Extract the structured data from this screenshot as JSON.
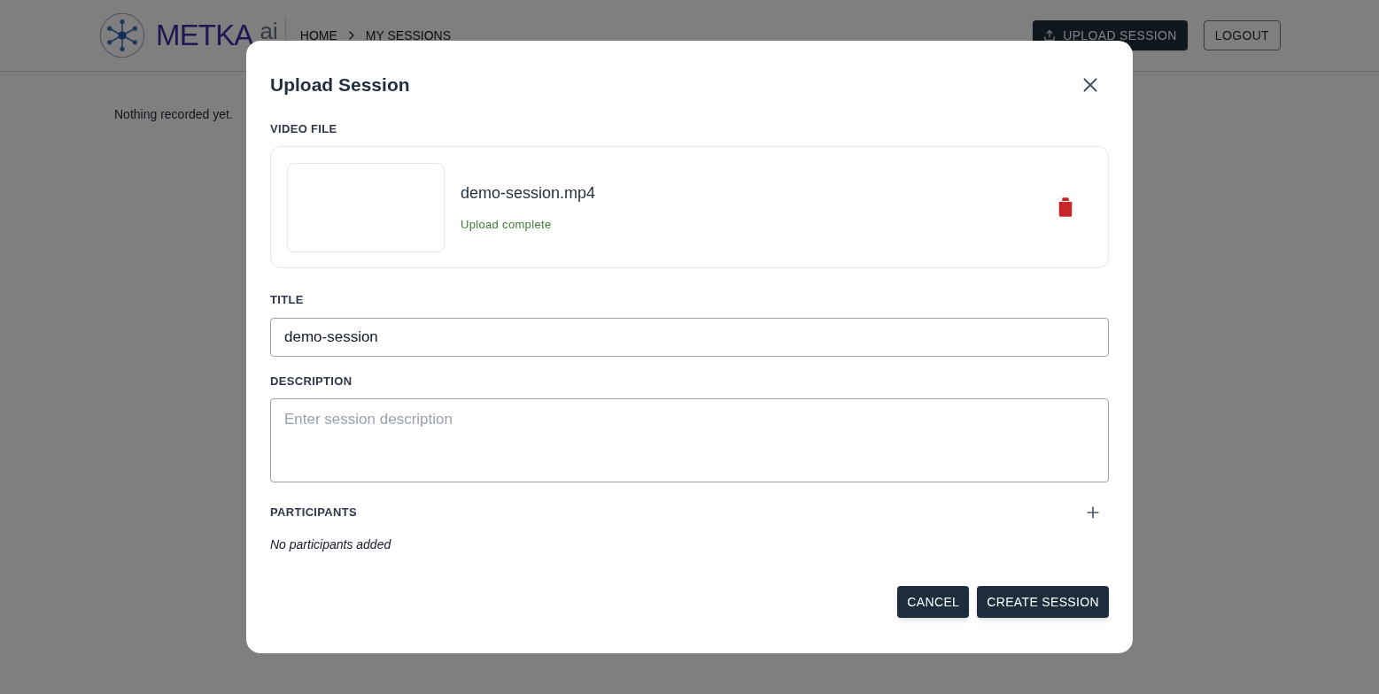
{
  "header": {
    "logo": {
      "name": "METKA",
      "suffix": "ai"
    },
    "breadcrumbs": [
      "HOME",
      "MY SESSIONS"
    ],
    "buttons": [
      {
        "label": "UPLOAD SESSION",
        "kind": "primary"
      },
      {
        "label": "LOGOUT",
        "kind": "outline"
      }
    ]
  },
  "page": {
    "empty_message": "Nothing recorded yet."
  },
  "dialog": {
    "title": "Upload Session",
    "video_file": {
      "label": "VIDEO FILE",
      "file_name": "demo-session.mp4",
      "status": "Upload complete"
    },
    "title_field": {
      "label": "TITLE",
      "value": "demo-session"
    },
    "description_field": {
      "label": "DESCRIPTION",
      "placeholder": "Enter session description"
    },
    "participants": {
      "label": "PARTICIPANTS",
      "empty_message": "No participants added"
    },
    "buttons": [
      {
        "label": "CANCEL"
      },
      {
        "label": "CREATE SESSION"
      }
    ]
  }
}
